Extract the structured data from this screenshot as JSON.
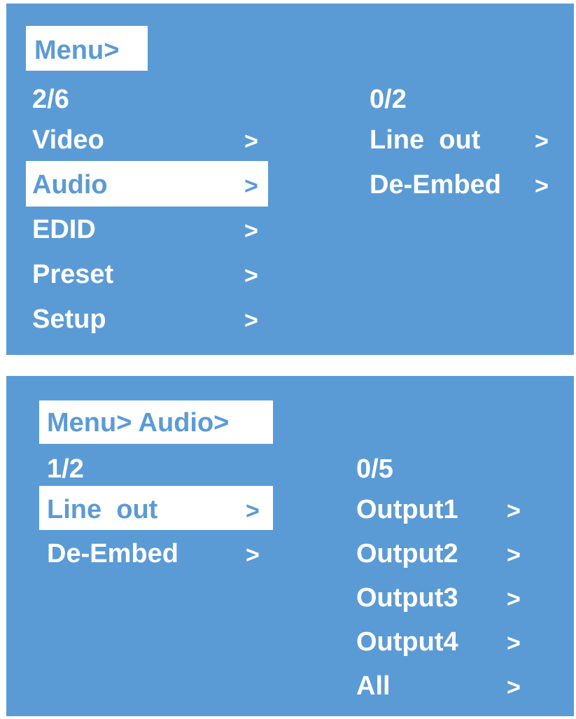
{
  "screen1": {
    "breadcrumb": "Menu>",
    "left_counter": "2/6",
    "menu_items": [
      {
        "label": "Video",
        "arrow": ">"
      },
      {
        "label": "Audio",
        "arrow": ">"
      },
      {
        "label": "EDID",
        "arrow": ">"
      },
      {
        "label": "Preset",
        "arrow": ">"
      },
      {
        "label": "Setup",
        "arrow": ">"
      }
    ],
    "right_counter": "0/2",
    "submenu_items": [
      {
        "label": "Line  out",
        "arrow": ">"
      },
      {
        "label": "De-Embed",
        "arrow": ">"
      }
    ]
  },
  "screen2": {
    "breadcrumb": "Menu> Audio>",
    "left_counter": "1/2",
    "menu_items": [
      {
        "label": "Line  out",
        "arrow": ">"
      },
      {
        "label": "De-Embed",
        "arrow": ">"
      }
    ],
    "right_counter": "0/5",
    "submenu_items": [
      {
        "label": "Output1",
        "arrow": ">"
      },
      {
        "label": "Output2",
        "arrow": ">"
      },
      {
        "label": "Output3",
        "arrow": ">"
      },
      {
        "label": "Output4",
        "arrow": ">"
      },
      {
        "label": "All",
        "arrow": ">"
      }
    ]
  },
  "colors": {
    "screen_bg": "#5b9bd5",
    "text": "#ffffff",
    "highlight_bg": "#ffffff",
    "highlight_text": "#5b9bd5"
  }
}
